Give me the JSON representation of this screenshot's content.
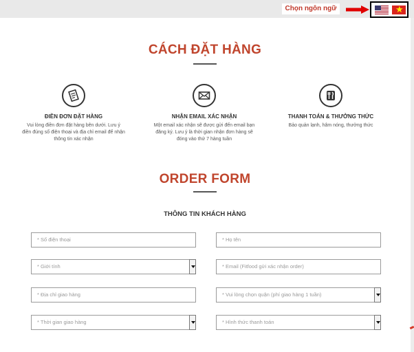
{
  "header": {
    "language_prompt": "Chọn ngôn ngữ",
    "flags": [
      "us-flag-icon",
      "vietnam-flag-icon"
    ]
  },
  "how_to_order": {
    "title": "CÁCH ĐẶT HÀNG",
    "steps": [
      {
        "icon": "order-form-icon",
        "title": "ĐIỀN ĐƠN ĐẶT HÀNG",
        "desc": "Vui lòng điền đơn đặt hàng bên dưới. Lưu ý điền đúng số điện thoại và địa chỉ email để nhận thông tin xác nhận"
      },
      {
        "icon": "email-icon",
        "title": "NHẬN EMAIL XÁC NHẬN",
        "desc": "Một email xác nhận sẽ được gửi đến email bạn đăng ký. Lưu ý là thời gian nhận đơn hàng sẽ đóng vào thứ 7 hàng tuần"
      },
      {
        "icon": "cutlery-icon",
        "title": "THANH TOÁN & THƯỞNG THỨC",
        "desc": "Bảo quản lạnh, hâm nóng, thưởng thức"
      }
    ]
  },
  "order_form": {
    "title": "ORDER FORM",
    "subtitle": "THÔNG TIN KHÁCH HÀNG",
    "fields": {
      "phone": "* Số điện thoại",
      "name": "* Họ tên",
      "gender": "* Giới tính",
      "email": "* Email (Fitfood gửi xác nhận order)",
      "address": "* Địa chỉ giao hàng",
      "district": "* Vui lòng chọn quận (phí giao hàng 1 tuần)",
      "delivery_time": "* Thời gian giao hàng",
      "payment": "* Hình thức thanh toán"
    }
  },
  "colors": {
    "accent": "#c0452d",
    "arrow": "#e00000"
  }
}
